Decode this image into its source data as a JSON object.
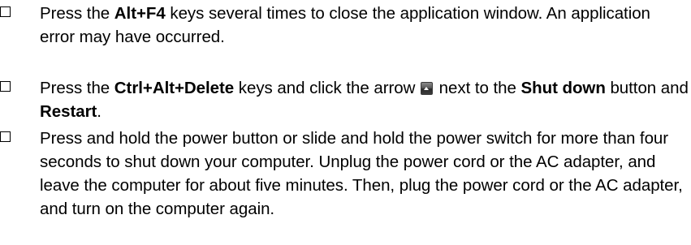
{
  "items": [
    {
      "t1": "Press the ",
      "b1": "Alt+F4",
      "t2": " keys several times to close the application window. An application error may have occurred."
    },
    {
      "t1": "Press the ",
      "b1": "Ctrl+Alt+Delete",
      "t2": " keys and click the arrow ",
      "icon": "up-arrow-icon",
      "t3": " next to the ",
      "b2": "Shut down",
      "t4": " button and ",
      "b3": "Restart",
      "t5": "."
    },
    {
      "t1": "Press and hold the power button or slide and hold the power switch for more than four seconds to shut down your computer. Unplug the power cord or the AC adapter, and leave the computer for about five minutes. Then, plug the power cord or the AC adapter, and turn on the computer again."
    }
  ]
}
